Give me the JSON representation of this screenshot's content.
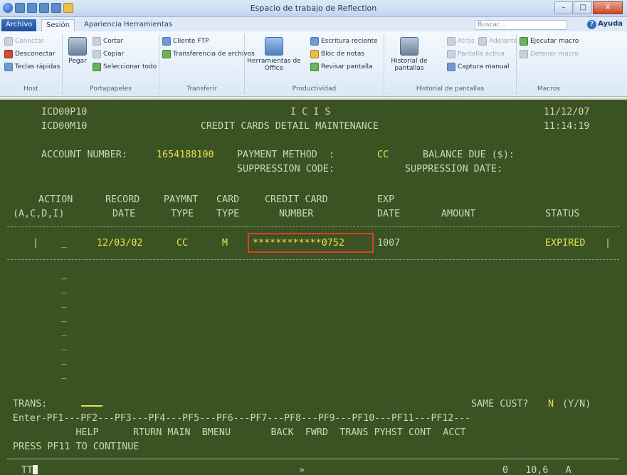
{
  "window": {
    "title": "Espacio de trabajo de Reflection",
    "minimize": "–",
    "maximize": "□",
    "close": "X"
  },
  "tabs": {
    "file": "Archivo",
    "session": "Sesión",
    "appearance": "Apariencia",
    "tools": "Herramientas"
  },
  "search": {
    "placeholder": "Buscar..."
  },
  "help": {
    "label": "Ayuda",
    "icon": "?"
  },
  "ribbon": {
    "host": {
      "connect": "Conectar",
      "disconnect": "Desconectar",
      "hotkeys": "Teclas rápidas",
      "label": "Host"
    },
    "clipboard": {
      "paste": "Pegar",
      "cut": "Cortar",
      "copy": "Copiar",
      "select_all": "Seleccionar todo",
      "label": "Portapapeles"
    },
    "transfer": {
      "ftp": "Cliente FTP",
      "file_transfer": "Transferencia de archivos",
      "label": "Transferir"
    },
    "productivity": {
      "office_tools": "Herramientas de Office",
      "recent_typing": "Escritura reciente",
      "notepad": "Bloc de notas",
      "spell_check": "Revisar pantalla",
      "label": "Productividad"
    },
    "screen_history": {
      "history": "Historial de pantallas",
      "back": "Atrás",
      "forward": "Adelante",
      "active_screen": "Pantalla activa",
      "manual_capture": "Captura manual",
      "label": "Historial de pantallas"
    },
    "macros": {
      "run": "Ejecutar macro",
      "stop": "Detener macro",
      "label": "Macros"
    }
  },
  "terminal": {
    "program_id": "ICD00P10",
    "map_id": "ICD00M10",
    "system": "I C I S",
    "screen_title": "CREDIT CARDS DETAIL MAINTENANCE",
    "date": "11/12/07",
    "time": "11:14:19",
    "account_label": "ACCOUNT NUMBER:",
    "account_number": "1654188100",
    "payment_method_label": "PAYMENT METHOD  :",
    "payment_method": "CC",
    "balance_due_label": "BALANCE DUE ($):",
    "suppression_code_label": "SUPPRESSION CODE:",
    "suppression_date_label": "SUPPRESSION DATE:",
    "headers": {
      "action1": "ACTION",
      "action2": "(A,C,D,I)",
      "record1": "RECORD",
      "record2": "DATE",
      "paymnt1": "PAYMNT",
      "paymnt2": "TYPE",
      "card1": "CARD",
      "card2": "TYPE",
      "ccnum1": "CREDIT CARD",
      "ccnum2": "NUMBER",
      "exp1": "EXP",
      "exp2": "DATE",
      "amount": "AMOUNT",
      "status": "STATUS"
    },
    "row": {
      "bar_left": "|",
      "action": "_",
      "record_date": "12/03/02",
      "payment_type": "CC",
      "card_type": "M",
      "card_number": "************0752",
      "exp_date": "1007",
      "status": "EXPIRED",
      "bar_right": "|"
    },
    "empty_rows": [
      "_",
      "_",
      "_",
      "_",
      "_",
      "_",
      "_",
      "_"
    ],
    "trans_label": "TRANS:",
    "same_cust_label": "SAME CUST?",
    "same_cust_value": "N",
    "same_cust_options": "(Y/N)",
    "pf_keys": "Enter-PF1---PF2---PF3---PF4---PF5---PF6---PF7---PF8---PF9---PF10---PF11---PF12---",
    "pf_labels": "      HELP      RTURN MAIN  BMENU       BACK  FWRD  TRANS PYHST CONT  ACCT",
    "message": "PRESS PF11 TO CONTINUE",
    "status_left": "TT",
    "status_mid": "»",
    "status_right": "0   10,6   A"
  }
}
